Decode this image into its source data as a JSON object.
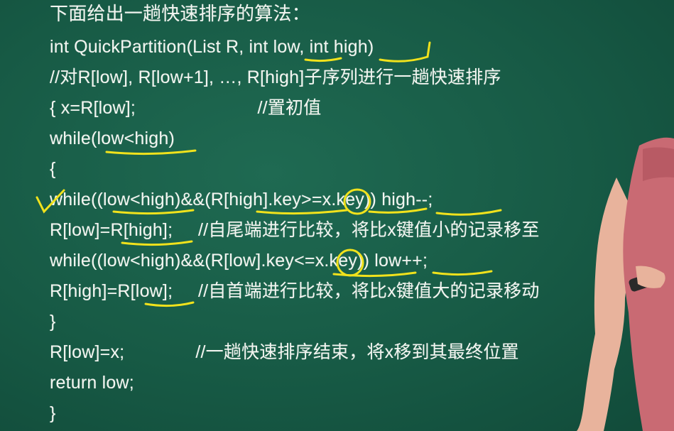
{
  "lines": [
    "下面给出一趟快速排序的算法：",
    "int QuickPartition(List R, int low, int high)",
    "//对R[low], R[low+1], …, R[high]子序列进行一趟快速排序",
    "{ x=R[low];                        //置初值",
    "while(low<high)",
    "{",
    "while((low<high)&&(R[high].key>=x.key)) high--;",
    "R[low]=R[high];     //自尾端进行比较，将比x键值小的记录移至",
    "while((low<high)&&(R[low].key<=x.key)) low++;",
    "R[high]=R[low];     //自首端进行比较，将比x键值大的记录移动",
    "}",
    "R[low]=x;              //一趟快速排序结束，将x移到其最终位置",
    "return low;",
    "}"
  ],
  "colors": {
    "board": "#175a45",
    "chalk": "#f2f5f0",
    "marker": "#f1e21c",
    "shirt": "#c96a73",
    "skin": "#e8b39c"
  }
}
